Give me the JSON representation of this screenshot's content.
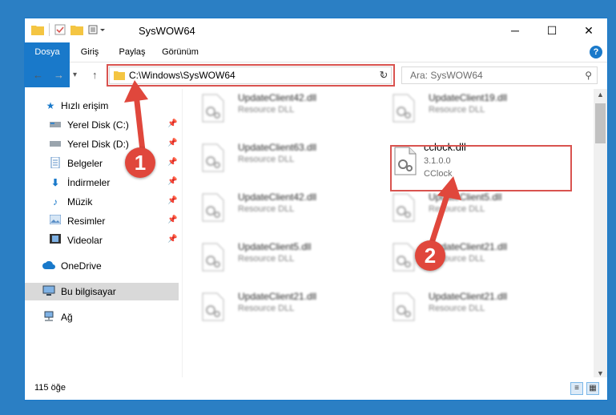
{
  "titlebar": {
    "title": "SysWOW64",
    "minimize": "─",
    "maximize": "☐",
    "close": "✕"
  },
  "ribbon": {
    "tabs": [
      "Dosya",
      "Giriş",
      "Paylaş",
      "Görünüm"
    ],
    "help": "?"
  },
  "address": {
    "path": "C:\\Windows\\SysWOW64",
    "search_placeholder": "Ara: SysWOW64"
  },
  "sidebar": {
    "items": [
      {
        "label": "Hızlı erişim",
        "icon": "star-icon"
      },
      {
        "label": "Yerel Disk (C:)",
        "icon": "drive-icon"
      },
      {
        "label": "Yerel Disk (D:)",
        "icon": "drive-icon"
      },
      {
        "label": "Belgeler",
        "icon": "documents-icon"
      },
      {
        "label": "İndirmeler",
        "icon": "download-icon"
      },
      {
        "label": "Müzik",
        "icon": "music-icon"
      },
      {
        "label": "Resimler",
        "icon": "pictures-icon"
      },
      {
        "label": "Videolar",
        "icon": "videos-icon"
      },
      {
        "label": "OneDrive",
        "icon": "cloud-icon"
      },
      {
        "label": "Bu bilgisayar",
        "icon": "computer-icon"
      },
      {
        "label": "Ağ",
        "icon": "network-icon"
      }
    ]
  },
  "files": [
    {
      "name": "UpdateClient42.dll",
      "line2": "Resource DLL"
    },
    {
      "name": "UpdateClient19.dll",
      "line2": "Resource DLL"
    },
    {
      "name": "UpdateClient63.dll",
      "line2": "Resource DLL"
    },
    {
      "name": "cclock.dll",
      "line2": "3.1.0.0",
      "line3": "CClock"
    },
    {
      "name": "UpdateClient42.dll",
      "line2": "Resource DLL"
    },
    {
      "name": "UpdateClient5.dll",
      "line2": "Resource DLL"
    },
    {
      "name": "UpdateClient5.dll",
      "line2": "Resource DLL"
    },
    {
      "name": "UpdateClient21.dll",
      "line2": "Resource DLL"
    },
    {
      "name": "UpdateClient21.dll",
      "line2": "Resource DLL"
    },
    {
      "name": "UpdateClient21.dll",
      "line2": "Resource DLL"
    }
  ],
  "status": {
    "count": "115 öğe"
  },
  "annotations": {
    "step1": "1",
    "step2": "2"
  },
  "colors": {
    "accent": "#1979ca",
    "highlight": "#d9534f",
    "badge": "#e0473c"
  }
}
